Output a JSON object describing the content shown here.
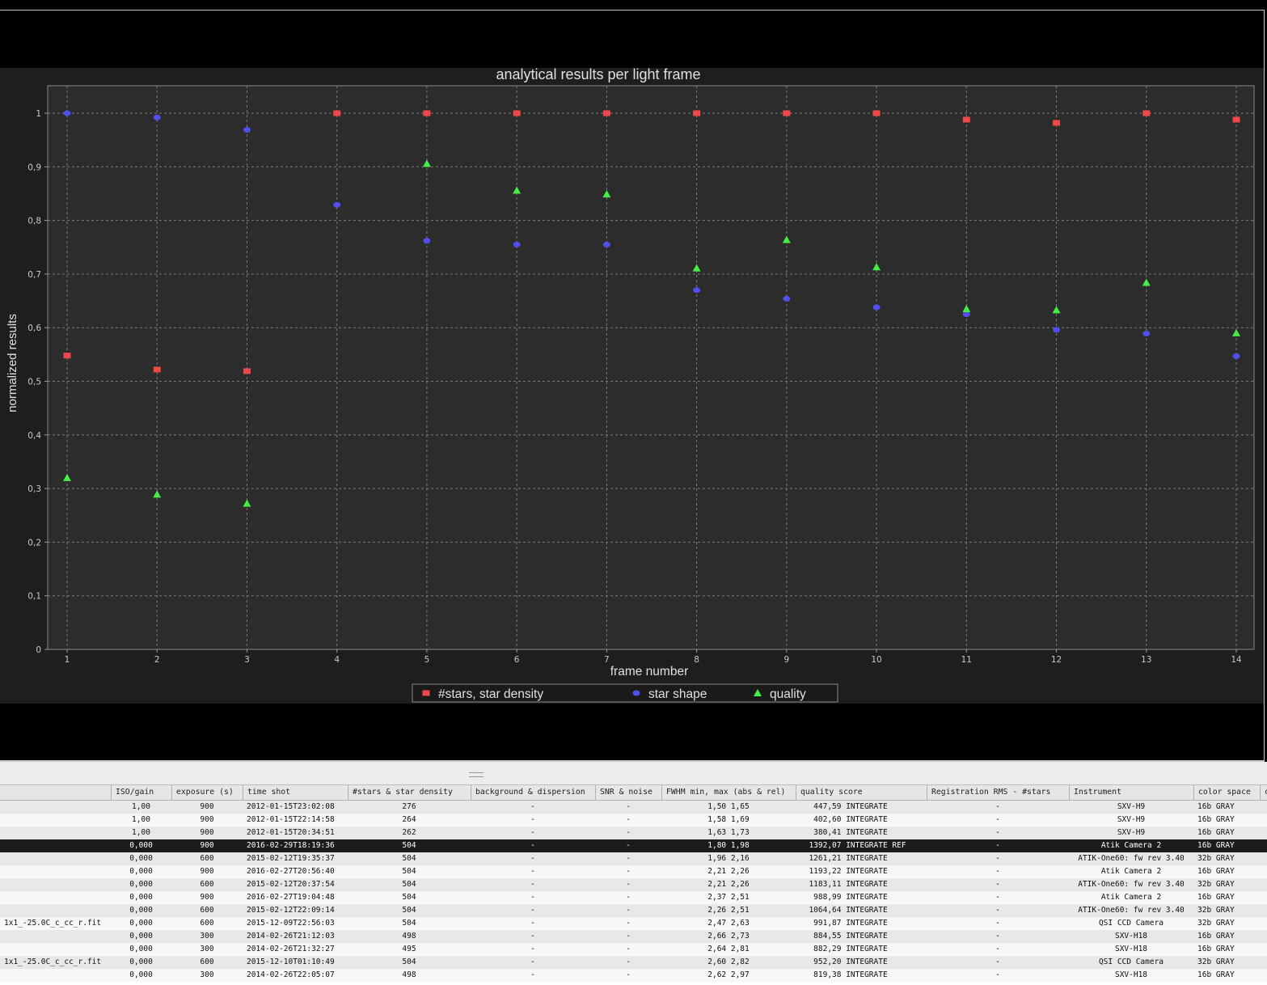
{
  "chart_data": {
    "type": "scatter",
    "title": "analytical results per light frame",
    "xlabel": "frame number",
    "ylabel": "normalized results",
    "xlim": [
      0.8,
      14.2
    ],
    "ylim": [
      0,
      1.05
    ],
    "x_ticks": [
      "1",
      "2",
      "3",
      "4",
      "5",
      "6",
      "7",
      "8",
      "9",
      "10",
      "11",
      "12",
      "13",
      "14"
    ],
    "y_ticks": [
      {
        "v": 0,
        "label": "0"
      },
      {
        "v": 0.1,
        "label": "0,1"
      },
      {
        "v": 0.2,
        "label": "0,2"
      },
      {
        "v": 0.3,
        "label": "0,3"
      },
      {
        "v": 0.4,
        "label": "0,4"
      },
      {
        "v": 0.5,
        "label": "0,5"
      },
      {
        "v": 0.6,
        "label": "0,6"
      },
      {
        "v": 0.7,
        "label": "0,7"
      },
      {
        "v": 0.8,
        "label": "0,8"
      },
      {
        "v": 0.9,
        "label": "0,9"
      },
      {
        "v": 1,
        "label": "1"
      }
    ],
    "grid": true,
    "legend_position": "bottom-center",
    "x": [
      1,
      2,
      3,
      4,
      5,
      6,
      7,
      8,
      9,
      10,
      11,
      12,
      13,
      14
    ],
    "series": [
      {
        "name": "#stars, star density",
        "color": "#f04848",
        "marker": "square",
        "values": [
          0.548,
          0.522,
          0.519,
          1.0,
          1.0,
          1.0,
          1.0,
          1.0,
          1.0,
          1.0,
          0.988,
          0.982,
          1.0,
          0.988
        ]
      },
      {
        "name": "star shape",
        "color": "#5050ee",
        "marker": "circle",
        "values": [
          1.0,
          0.992,
          0.969,
          0.829,
          0.762,
          0.755,
          0.755,
          0.67,
          0.654,
          0.638,
          0.625,
          0.596,
          0.589,
          0.547
        ]
      },
      {
        "name": "quality",
        "color": "#44ee44",
        "marker": "triangle",
        "values": [
          0.32,
          0.289,
          0.272,
          null,
          0.906,
          0.856,
          0.849,
          0.711,
          0.764,
          0.713,
          0.635,
          0.633,
          0.684,
          0.59
        ]
      }
    ]
  },
  "table": {
    "columns": [
      {
        "label": "",
        "align": "l"
      },
      {
        "label": "ISO/gain",
        "align": "c"
      },
      {
        "label": "exposure (s)",
        "align": "c"
      },
      {
        "label": "time shot",
        "align": "l"
      },
      {
        "label": "#stars & star density",
        "align": "c"
      },
      {
        "label": "background & dispersion",
        "align": "c"
      },
      {
        "label": "SNR & noise",
        "align": "c"
      },
      {
        "label": "FWHM min, max (abs & rel)",
        "align": "c"
      },
      {
        "label": "quality score",
        "align": "l"
      },
      {
        "label": "Registration RMS - #stars",
        "align": "c"
      },
      {
        "label": "Instrument",
        "align": "c"
      },
      {
        "label": "color space",
        "align": "l"
      },
      {
        "label": "c",
        "align": "l"
      }
    ],
    "rows": [
      [
        "",
        "1,00",
        "900",
        "2012-01-15T23:02:08",
        "276",
        "-",
        "-",
        "1,50 1,65",
        "   447,59 INTEGRATE",
        "-",
        "SXV-H9",
        "16b GRAY",
        ""
      ],
      [
        "",
        "1,00",
        "900",
        "2012-01-15T22:14:58",
        "264",
        "-",
        "-",
        "1,58 1,69",
        "   402,60 INTEGRATE",
        "-",
        "SXV-H9",
        "16b GRAY",
        ""
      ],
      [
        "",
        "1,00",
        "900",
        "2012-01-15T20:34:51",
        "262",
        "-",
        "-",
        "1,63 1,73",
        "   380,41 INTEGRATE",
        "-",
        "SXV-H9",
        "16b GRAY",
        ""
      ],
      [
        "",
        "0,000",
        "900",
        "2016-02-29T18:19:36",
        "504",
        "-",
        "-",
        "1,80 1,98",
        "  1392,07 INTEGRATE REF",
        "-",
        "Atik Camera 2",
        "16b GRAY",
        ""
      ],
      [
        "",
        "0,000",
        "600",
        "2015-02-12T19:35:37",
        "504",
        "-",
        "-",
        "1,96 2,16",
        "  1261,21 INTEGRATE",
        "-",
        "ATIK-One60: fw rev 3.40",
        "32b GRAY",
        ""
      ],
      [
        "",
        "0,000",
        "900",
        "2016-02-27T20:56:40",
        "504",
        "-",
        "-",
        "2,21 2,26",
        "  1193,22 INTEGRATE",
        "-",
        "Atik Camera 2",
        "16b GRAY",
        ""
      ],
      [
        "",
        "0,000",
        "600",
        "2015-02-12T20:37:54",
        "504",
        "-",
        "-",
        "2,21 2,26",
        "  1183,11 INTEGRATE",
        "-",
        "ATIK-One60: fw rev 3.40",
        "32b GRAY",
        ""
      ],
      [
        "",
        "0,000",
        "900",
        "2016-02-27T19:04:48",
        "504",
        "-",
        "-",
        "2,37 2,51",
        "   988,99 INTEGRATE",
        "-",
        "Atik Camera 2",
        "16b GRAY",
        ""
      ],
      [
        "",
        "0,000",
        "600",
        "2015-02-12T22:09:14",
        "504",
        "-",
        "-",
        "2,26 2,51",
        "  1064,64 INTEGRATE",
        "-",
        "ATIK-One60: fw rev 3.40",
        "32b GRAY",
        ""
      ],
      [
        "1x1_-25.0C_c_cc_r.fit",
        "0,000",
        "600",
        "2015-12-09T22:56:03",
        "504",
        "-",
        "-",
        "2,47 2,63",
        "   991,87 INTEGRATE",
        "-",
        "QSI CCD Camera",
        "32b GRAY",
        ""
      ],
      [
        "",
        "0,000",
        "300",
        "2014-02-26T21:12:03",
        "498",
        "-",
        "-",
        "2,66 2,73",
        "   884,55 INTEGRATE",
        "-",
        "SXV-H18",
        "16b GRAY",
        ""
      ],
      [
        "",
        "0,000",
        "300",
        "2014-02-26T21:32:27",
        "495",
        "-",
        "-",
        "2,64 2,81",
        "   882,29 INTEGRATE",
        "-",
        "SXV-H18",
        "16b GRAY",
        ""
      ],
      [
        "1x1_-25.0C_c_cc_r.fit",
        "0,000",
        "600",
        "2015-12-10T01:10:49",
        "504",
        "-",
        "-",
        "2,60 2,82",
        "   952,20 INTEGRATE",
        "-",
        "QSI CCD Camera",
        "32b GRAY",
        ""
      ],
      [
        "",
        "0,000",
        "300",
        "2014-02-26T22:05:07",
        "498",
        "-",
        "-",
        "2,62 2,97",
        "   819,38 INTEGRATE",
        "-",
        "SXV-H18",
        "16b GRAY",
        ""
      ]
    ],
    "selected_row": 3
  }
}
